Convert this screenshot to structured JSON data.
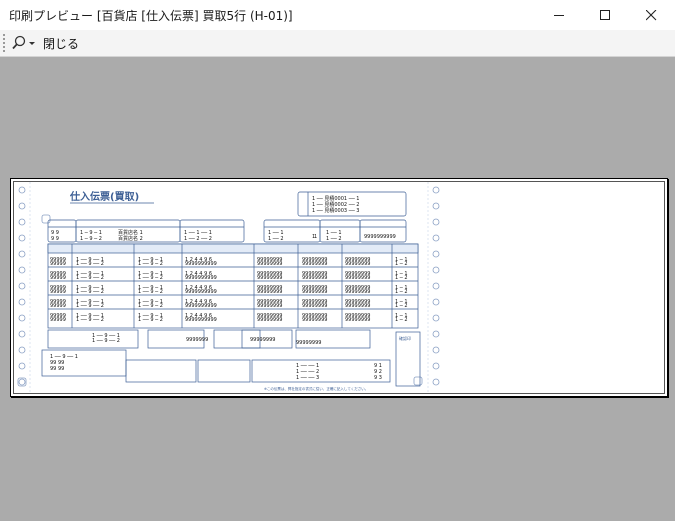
{
  "window": {
    "title": "印刷プレビュー [百貨店 [仕入伝票] 買取5行 (H-01)]",
    "minimize_icon": "minimize-icon",
    "maximize_icon": "maximize-icon",
    "close_icon": "close-icon"
  },
  "toolbar": {
    "zoom_icon": "magnifier-icon",
    "close_label": "閉じる"
  },
  "form": {
    "title": "仕入伝票(買取)",
    "confirm_label": "確認印",
    "footer_note": "※この伝票は、弊社指定の書式に従い、正確に記入してください。",
    "page_marker": "1",
    "colors": {
      "form_blue": "#3d5f95",
      "fill_blue": "#e3ebf7",
      "text": "#111111"
    }
  }
}
